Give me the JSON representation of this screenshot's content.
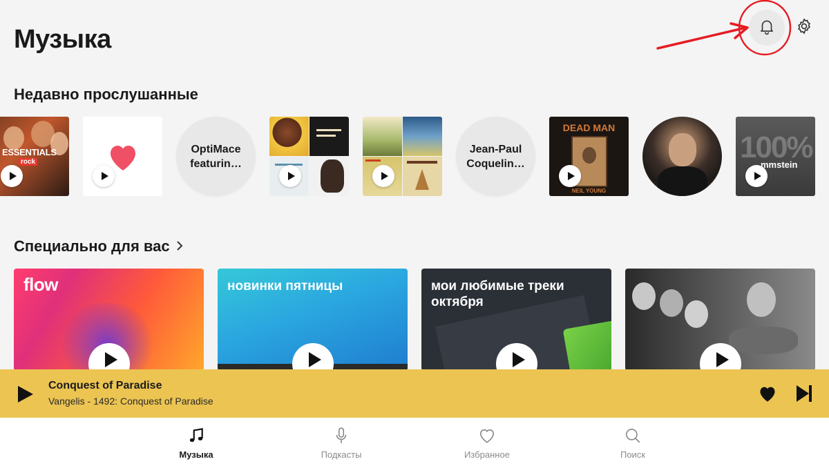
{
  "header": {
    "title": "Музыка"
  },
  "sections": {
    "recent": "Недавно прослушанные",
    "special": "Специально для вас"
  },
  "recent": {
    "essentials_label": "ESSENTIALS",
    "essentials_sub": "rock",
    "optimace_label": "OptiMace featurin…",
    "jean_paul_label": "Jean-Paul Coquelin…",
    "dead_man_label": "DEAD MAN",
    "dead_man_artist": "NEIL YOUNG",
    "rammstein_label": "mmstein"
  },
  "cards": {
    "flow": "flow",
    "new_friday": "новинки пятницы",
    "favorites": "мои любимые треки октября"
  },
  "player": {
    "title": "Conquest of Paradise",
    "artist": "Vangelis - 1492: Conquest of Paradise"
  },
  "nav": {
    "music": "Музыка",
    "podcasts": "Подкасты",
    "favorites": "Избранное",
    "search": "Поиск"
  },
  "colors": {
    "player_bg": "#ecc452",
    "annotation": "#e51c23",
    "heart": "#ef5065"
  }
}
